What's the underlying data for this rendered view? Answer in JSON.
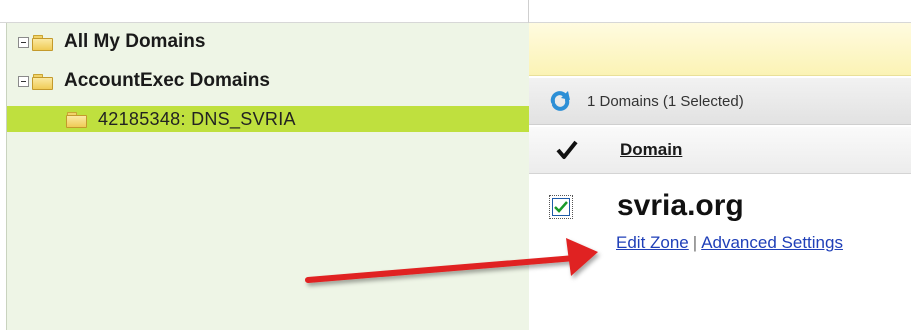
{
  "tree": {
    "items": [
      {
        "label": "All My Domains",
        "expander": "minus",
        "icon": "folder-icon"
      },
      {
        "label": "AccountExec Domains",
        "expander": "minus",
        "icon": "folder-icon"
      },
      {
        "label": "42185348: DNS_SVRIA",
        "icon": "folder-icon",
        "selected": true
      }
    ]
  },
  "grid": {
    "summary": "1 Domains (1 Selected)",
    "refresh_icon": "refresh-icon",
    "header": {
      "check_icon": "checkmark-icon",
      "domain_col": "Domain"
    },
    "rows": [
      {
        "checked": true,
        "domain": "svria.org",
        "links": {
          "edit_zone": "Edit Zone",
          "separator": "|",
          "advanced_settings": "Advanced Settings"
        }
      }
    ]
  },
  "colors": {
    "tree_bg": "#eef5e6",
    "selected_row": "#bfe03e",
    "link": "#1f3fb8",
    "annotation_arrow": "#e02020"
  }
}
